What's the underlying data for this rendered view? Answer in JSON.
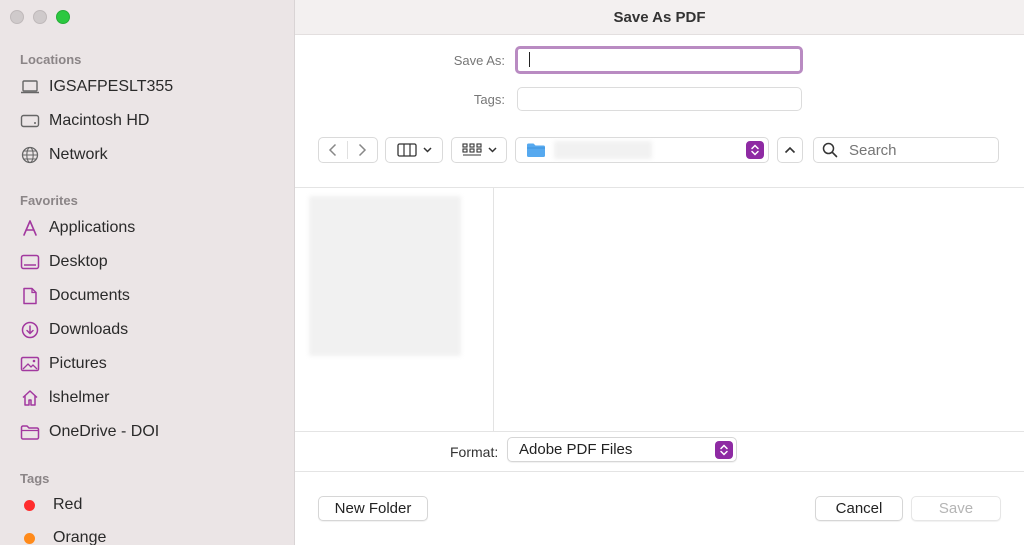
{
  "window": {
    "title": "Save As PDF"
  },
  "sidebar": {
    "sections": {
      "locations": "Locations",
      "favorites": "Favorites",
      "tags": "Tags"
    },
    "locations": [
      {
        "label": "IGSAFPESLT355",
        "icon": "laptop-icon"
      },
      {
        "label": "Macintosh HD",
        "icon": "hard-drive-icon"
      },
      {
        "label": "Network",
        "icon": "globe-icon"
      }
    ],
    "favorites": [
      {
        "label": "Applications",
        "icon": "applications-icon"
      },
      {
        "label": "Desktop",
        "icon": "desktop-icon"
      },
      {
        "label": "Documents",
        "icon": "document-icon"
      },
      {
        "label": "Downloads",
        "icon": "download-icon"
      },
      {
        "label": "Pictures",
        "icon": "pictures-icon"
      },
      {
        "label": "lshelmer",
        "icon": "home-icon"
      },
      {
        "label": "OneDrive - DOI",
        "icon": "folder-icon"
      }
    ],
    "tags": [
      {
        "label": "Red",
        "color": "#ff2d2d"
      },
      {
        "label": "Orange",
        "color": "#ff8a1a"
      }
    ]
  },
  "form": {
    "save_as_label": "Save As:",
    "save_as_value": "",
    "tags_label": "Tags:",
    "tags_value": ""
  },
  "toolbar": {
    "search_placeholder": "Search"
  },
  "footer": {
    "format_label": "Format:",
    "format_value": "Adobe PDF Files",
    "new_folder": "New Folder",
    "cancel": "Cancel",
    "save": "Save"
  },
  "colors": {
    "accent": "#8e2aa3",
    "sidebar_icon": "#a2389f",
    "focus_ring": "#b98bc2"
  }
}
